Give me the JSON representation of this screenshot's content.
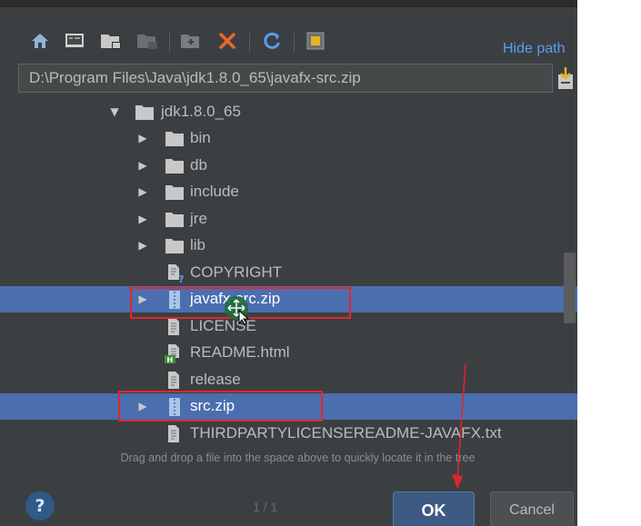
{
  "toolbar": {
    "icons": [
      "home-icon",
      "desktop-icon",
      "project-folder-icon",
      "module-folder-icon",
      "new-folder-icon",
      "delete-icon",
      "refresh-icon",
      "show-hidden-icon"
    ],
    "hide_path_label": "Hide path"
  },
  "path_field": {
    "value": "D:\\Program Files\\Java\\jdk1.8.0_65\\javafx-src.zip"
  },
  "tree": {
    "items": [
      {
        "label": "jdk1.8.0_65",
        "type": "folder",
        "expanded": true
      },
      {
        "label": "bin",
        "type": "folder"
      },
      {
        "label": "db",
        "type": "folder"
      },
      {
        "label": "include",
        "type": "folder"
      },
      {
        "label": "jre",
        "type": "folder"
      },
      {
        "label": "lib",
        "type": "folder"
      },
      {
        "label": "COPYRIGHT",
        "type": "file-unknown"
      },
      {
        "label": "javafx-src.zip",
        "type": "archive",
        "selected": true
      },
      {
        "label": "LICENSE",
        "type": "file-text"
      },
      {
        "label": "README.html",
        "type": "file-html"
      },
      {
        "label": "release",
        "type": "file-text"
      },
      {
        "label": "src.zip",
        "type": "archive",
        "selected": true
      },
      {
        "label": "THIRDPARTYLICENSEREADME-JAVAFX.txt",
        "type": "file-text"
      }
    ]
  },
  "hint": "Drag and drop a file into the space above to quickly locate it in the tree",
  "buttons": {
    "help": "?",
    "ok": "OK",
    "cancel": "Cancel"
  },
  "pager": "1 / 1",
  "colors": {
    "background": "#3c3f41",
    "selection": "#4b6eaf",
    "annotation": "#e0262d",
    "link": "#589df6"
  }
}
